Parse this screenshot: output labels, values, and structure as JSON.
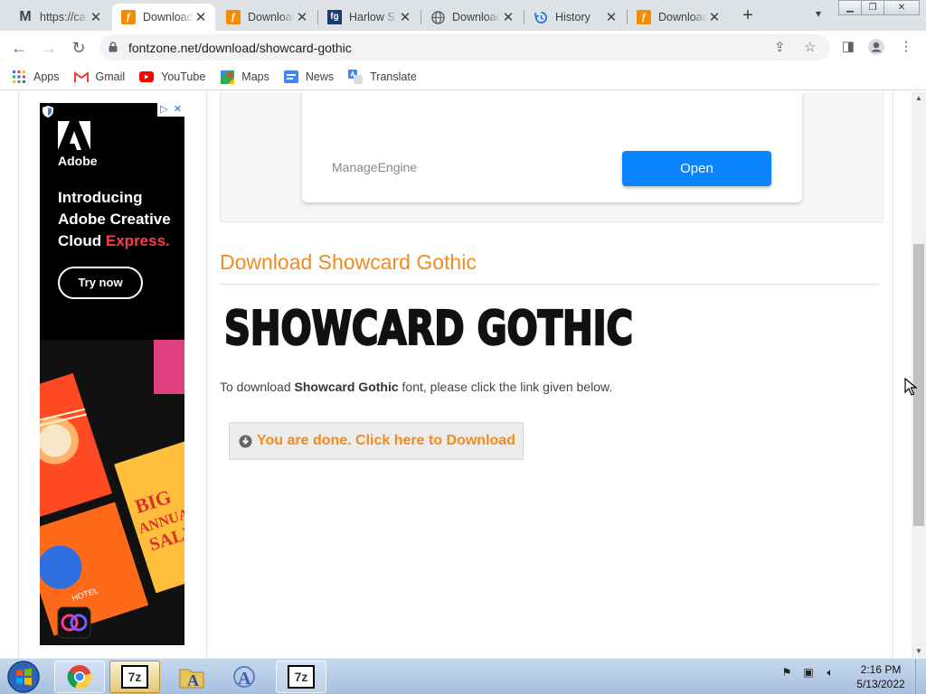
{
  "browser": {
    "tabs": [
      {
        "title": "https://ca",
        "favicon": "gmail-icon",
        "active": false
      },
      {
        "title": "Download",
        "favicon": "fontzone-icon",
        "active": true
      },
      {
        "title": "Download",
        "favicon": "fontzone-icon",
        "active": false
      },
      {
        "title": "Harlow S",
        "favicon": "fontget-icon",
        "active": false
      },
      {
        "title": "Download",
        "favicon": "globe-icon",
        "active": false
      },
      {
        "title": "History",
        "favicon": "history-icon",
        "active": false
      },
      {
        "title": "Download",
        "favicon": "fontzone-icon",
        "active": false
      }
    ],
    "url": "fontzone.net/download/showcard-gothic",
    "bookmarks": [
      {
        "label": "Apps",
        "icon": "apps-grid-icon"
      },
      {
        "label": "Gmail",
        "icon": "gmail-icon"
      },
      {
        "label": "YouTube",
        "icon": "youtube-icon"
      },
      {
        "label": "Maps",
        "icon": "maps-icon"
      },
      {
        "label": "News",
        "icon": "news-icon"
      },
      {
        "label": "Translate",
        "icon": "translate-icon"
      }
    ]
  },
  "side_ad": {
    "brand": "Adobe",
    "headline_1": "Introducing Adobe Creative Cloud",
    "headline_2": "Express.",
    "cta": "Try now",
    "accent_color": "#ff3a4a"
  },
  "top_ad": {
    "brand": "ManageEngine",
    "button": "Open",
    "button_color": "#0a84ff"
  },
  "page": {
    "title": "Download Showcard Gothic",
    "font_preview": "SHOWCARD GOTHIC",
    "desc_prefix": "To download ",
    "desc_font": "Showcard Gothic",
    "desc_suffix": " font, please click the link given below.",
    "download_button": "You are done. Click here to Download",
    "accent_color": "#ee8b22"
  },
  "taskbar": {
    "items": [
      {
        "name": "chrome-icon"
      },
      {
        "name": "7zip-icon",
        "selected": true
      },
      {
        "name": "font-folder-icon"
      },
      {
        "name": "font-viewer-icon"
      },
      {
        "name": "7zip-icon"
      }
    ],
    "time": "2:16 PM",
    "date": "5/13/2022"
  }
}
